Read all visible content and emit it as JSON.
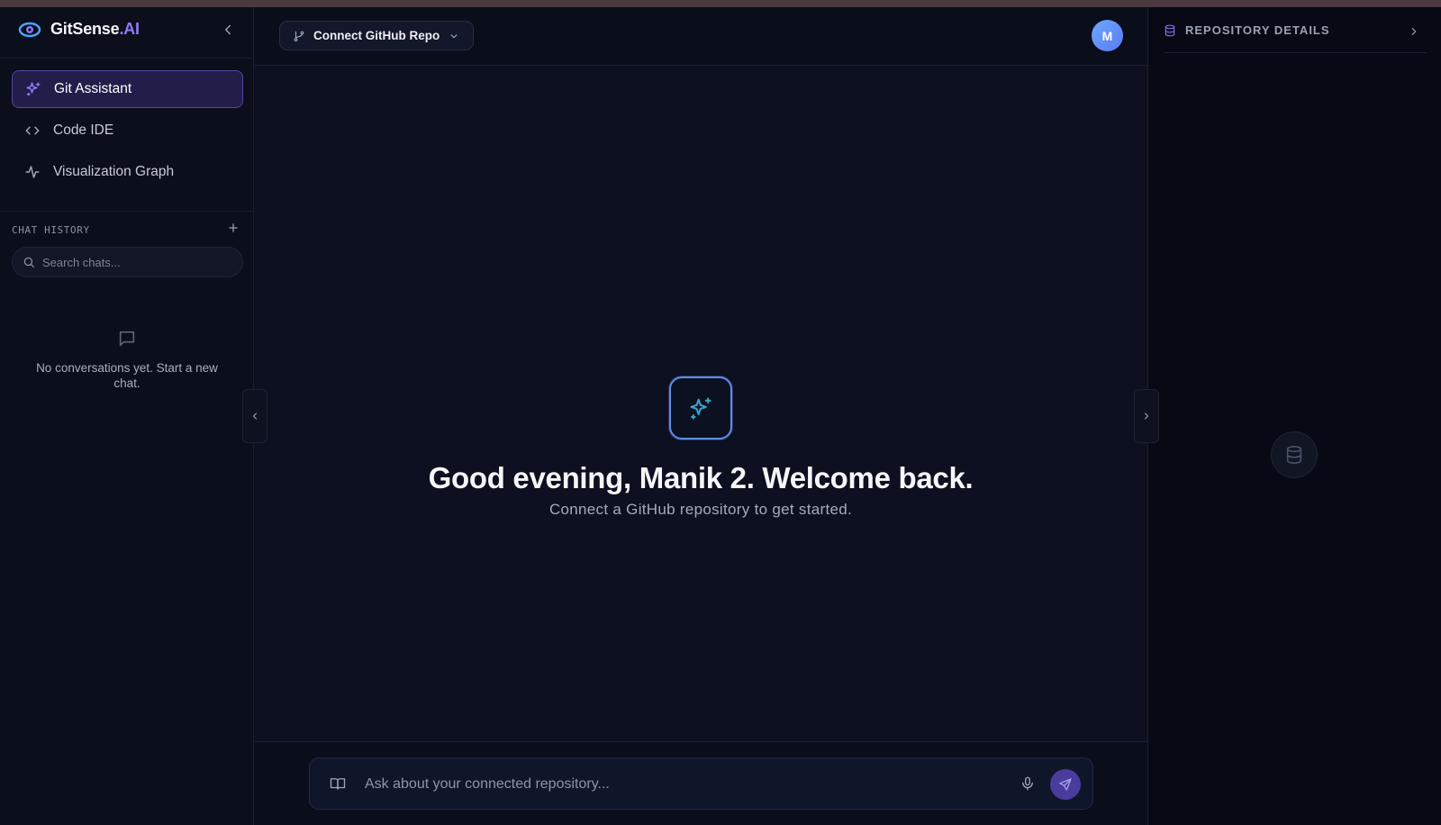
{
  "brand": {
    "name": "GitSense",
    "suffix": ".AI"
  },
  "sidebar": {
    "nav": [
      {
        "label": "Git Assistant",
        "icon": "sparkles-icon",
        "active": true
      },
      {
        "label": "Code IDE",
        "icon": "code-icon",
        "active": false
      },
      {
        "label": "Visualization Graph",
        "icon": "activity-icon",
        "active": false
      }
    ],
    "history": {
      "title": "CHAT HISTORY",
      "search_placeholder": "Search chats...",
      "empty_text": "No conversations yet. Start a new chat."
    }
  },
  "header": {
    "connect_label": "Connect GitHub Repo",
    "avatar_initial": "M"
  },
  "main": {
    "greeting": "Good evening, Manik 2. Welcome back.",
    "subtext": "Connect a GitHub repository to get started."
  },
  "composer": {
    "placeholder": "Ask about your connected repository..."
  },
  "right_panel": {
    "title": "REPOSITORY DETAILS"
  },
  "colors": {
    "accent": "#8b7cf6",
    "background": "#0a0d1a",
    "active_nav_bg": "#231d4a"
  }
}
